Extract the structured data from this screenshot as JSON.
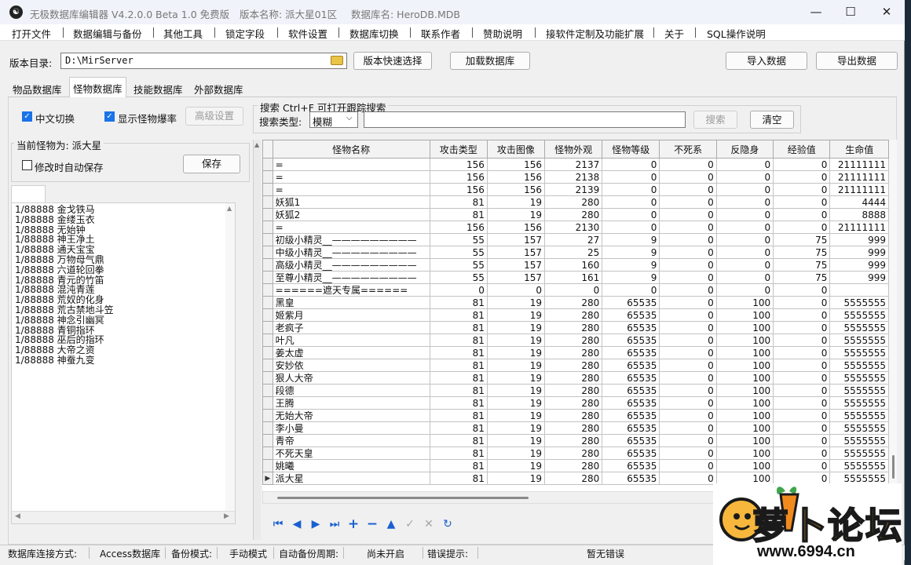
{
  "window": {
    "title_parts": [
      "无极数据库编辑器 V4.2.0.0",
      "Beta 1.0 免费版",
      "版本名称: 派大星01区",
      "数据库名: HeroDB.MDB"
    ],
    "minimize": "—",
    "maximize": "☐",
    "close": "✕"
  },
  "menu": [
    "打开文件",
    "数据编辑与备份",
    "其他工具",
    "锁定字段",
    "软件设置",
    "数据库切换",
    "联系作者",
    "赞助说明",
    "接软件定制及功能扩展",
    "关于",
    "SQL操作说明"
  ],
  "toolbar": {
    "dir_label": "版本目录:",
    "dir_value": "D:\\MirServer",
    "quick_select": "版本快速选择",
    "load_db": "加载数据库",
    "import": "导入数据",
    "export": "导出数据"
  },
  "tabs": [
    "物品数据库",
    "怪物数据库",
    "技能数据库",
    "外部数据库"
  ],
  "active_tab": 1,
  "options": {
    "chinese_switch": "中文切换",
    "show_drop_rate": "显示怪物爆率",
    "advanced": "高级设置"
  },
  "search": {
    "legend": "搜索  Ctrl+F 可打开跟踪搜索",
    "type_label": "搜索类型:",
    "type_value": "模糊",
    "search_btn": "搜索",
    "clear_btn": "清空"
  },
  "monster_panel": {
    "current_label": "当前怪物为: 派大星",
    "auto_save": "修改时自动保存",
    "save_btn": "保存",
    "drops": [
      "1/88888 金戈铁马",
      "1/88888 金缕玉衣",
      "1/88888 无始钟",
      "1/88888 神王净土",
      "1/88888 通天宝宝",
      "1/88888 万物母气鼎",
      "1/88888 六道轮回拳",
      "1/88888 青元的竹笛",
      "1/88888 混沌青莲",
      "1/88888 荒奴的化身",
      "1/88888 荒古禁地斗笠",
      "1/88888 神念引幽冥",
      "1/88888 青铜指环",
      "1/88888 巫后的指环",
      "1/88888 大帝之资",
      "1/88888 神蚕九变"
    ]
  },
  "grid": {
    "columns": [
      "怪物名称",
      "攻击类型",
      "攻击图像",
      "怪物外观",
      "怪物等级",
      "不死系",
      "反隐身",
      "经验值",
      "生命值"
    ],
    "current_row_marker": "▶",
    "rows": [
      [
        "=",
        "156",
        "156",
        "2137",
        "0",
        "0",
        "0",
        "0",
        "21111111"
      ],
      [
        "=",
        "156",
        "156",
        "2138",
        "0",
        "0",
        "0",
        "0",
        "21111111"
      ],
      [
        "=",
        "156",
        "156",
        "2139",
        "0",
        "0",
        "0",
        "0",
        "21111111"
      ],
      [
        "妖狐1",
        "81",
        "19",
        "280",
        "0",
        "0",
        "0",
        "0",
        "4444"
      ],
      [
        "妖狐2",
        "81",
        "19",
        "280",
        "0",
        "0",
        "0",
        "0",
        "8888"
      ],
      [
        "=",
        "156",
        "156",
        "2130",
        "0",
        "0",
        "0",
        "0",
        "21111111"
      ],
      [
        "初级小精灵__—————————",
        "55",
        "157",
        "27",
        "9",
        "0",
        "0",
        "75",
        "999"
      ],
      [
        "中级小精灵__—————————",
        "55",
        "157",
        "25",
        "9",
        "0",
        "0",
        "75",
        "999"
      ],
      [
        "高级小精灵__—————————",
        "55",
        "157",
        "160",
        "9",
        "0",
        "0",
        "75",
        "999"
      ],
      [
        "至尊小精灵__—————————",
        "55",
        "157",
        "161",
        "9",
        "0",
        "0",
        "75",
        "999"
      ],
      [
        "======遮天专属======",
        "0",
        "0",
        "0",
        "0",
        "0",
        "0",
        "0",
        ""
      ],
      [
        "黑皇",
        "81",
        "19",
        "280",
        "65535",
        "0",
        "100",
        "0",
        "5555555"
      ],
      [
        "姬紫月",
        "81",
        "19",
        "280",
        "65535",
        "0",
        "100",
        "0",
        "5555555"
      ],
      [
        "老疯子",
        "81",
        "19",
        "280",
        "65535",
        "0",
        "100",
        "0",
        "5555555"
      ],
      [
        "叶凡",
        "81",
        "19",
        "280",
        "65535",
        "0",
        "100",
        "0",
        "5555555"
      ],
      [
        "姜太虚",
        "81",
        "19",
        "280",
        "65535",
        "0",
        "100",
        "0",
        "5555555"
      ],
      [
        "安妙依",
        "81",
        "19",
        "280",
        "65535",
        "0",
        "100",
        "0",
        "5555555"
      ],
      [
        "狠人大帝",
        "81",
        "19",
        "280",
        "65535",
        "0",
        "100",
        "0",
        "5555555"
      ],
      [
        "段德",
        "81",
        "19",
        "280",
        "65535",
        "0",
        "100",
        "0",
        "5555555"
      ],
      [
        "王腾",
        "81",
        "19",
        "280",
        "65535",
        "0",
        "100",
        "0",
        "5555555"
      ],
      [
        "无始大帝",
        "81",
        "19",
        "280",
        "65535",
        "0",
        "100",
        "0",
        "5555555"
      ],
      [
        "李小曼",
        "81",
        "19",
        "280",
        "65535",
        "0",
        "100",
        "0",
        "5555555"
      ],
      [
        "青帝",
        "81",
        "19",
        "280",
        "65535",
        "0",
        "100",
        "0",
        "5555555"
      ],
      [
        "不死天皇",
        "81",
        "19",
        "280",
        "65535",
        "0",
        "100",
        "0",
        "5555555"
      ],
      [
        "姚曦",
        "81",
        "19",
        "280",
        "65535",
        "0",
        "100",
        "0",
        "5555555"
      ],
      [
        "派大星",
        "81",
        "19",
        "280",
        "65535",
        "0",
        "100",
        "0",
        "5555555"
      ]
    ]
  },
  "navigator": [
    "first",
    "prior",
    "next",
    "last",
    "insert",
    "delete",
    "edit",
    "post",
    "cancel",
    "refresh"
  ],
  "status": {
    "conn_label": "数据库连接方式:",
    "conn_value": "Access数据库",
    "backup_label": "备份模式:",
    "backup_value": "手动模式",
    "cycle_label": "自动备份周期:",
    "cycle_value": "尚未开启",
    "error_label": "错误提示:",
    "error_value": "暂无错误"
  },
  "watermark": {
    "text": "萝卜论坛",
    "url": "www.6994.cn"
  },
  "colors": {
    "accent": "#1a73e8",
    "nav_blue": "#1a5fd0"
  }
}
